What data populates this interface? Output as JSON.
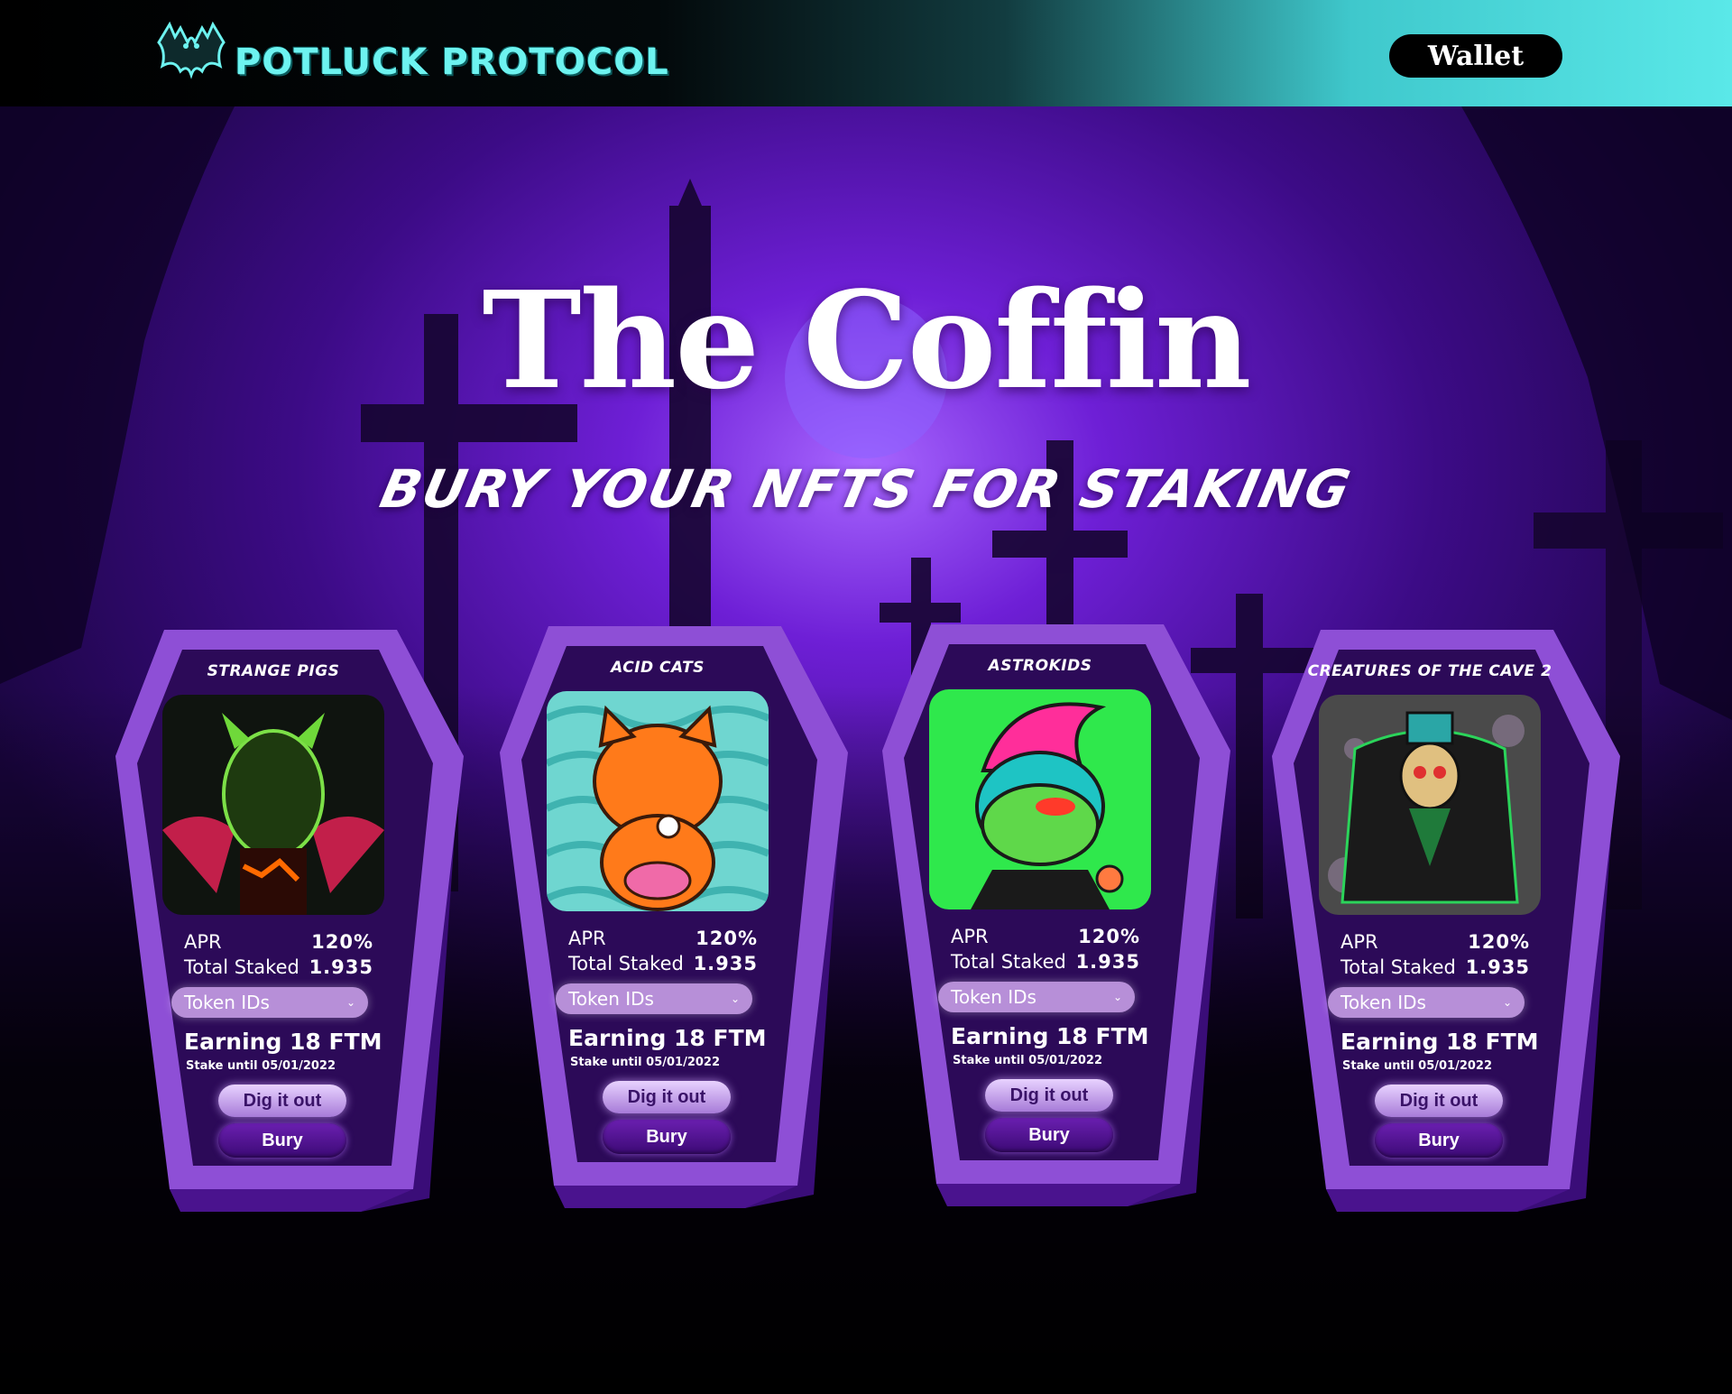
{
  "header": {
    "brand": "POTLUCK PROTOCOL",
    "wallet_label": "Wallet"
  },
  "hero": {
    "title": "The Coffin",
    "subtitle": "BURY YOUR NFTS FOR STAKING"
  },
  "colors": {
    "accent": "#6df3f0",
    "coffin_purple": "#7b2fc6",
    "background": "#2a0a55"
  },
  "coffins": [
    {
      "title": "Strange Pigs",
      "apr_label": "APR",
      "apr": "120%",
      "staked_label": "Total Staked",
      "staked": "1.935",
      "token_label": "Token IDs",
      "earning": "Earning 18 FTM",
      "stake_until": "Stake until 05/01/2022",
      "dig_label": "Dig it out",
      "bury_label": "Bury"
    },
    {
      "title": "Acid Cats",
      "apr_label": "APR",
      "apr": "120%",
      "staked_label": "Total Staked",
      "staked": "1.935",
      "token_label": "Token IDs",
      "earning": "Earning 18 FTM",
      "stake_until": "Stake until 05/01/2022",
      "dig_label": "Dig it out",
      "bury_label": "Bury"
    },
    {
      "title": "Astrokids",
      "apr_label": "APR",
      "apr": "120%",
      "staked_label": "Total Staked",
      "staked": "1.935",
      "token_label": "Token IDs",
      "earning": "Earning 18 FTM",
      "stake_until": "Stake until 05/01/2022",
      "dig_label": "Dig it out",
      "bury_label": "Bury"
    },
    {
      "title": "Creatures of the Cave 2",
      "apr_label": "APR",
      "apr": "120%",
      "staked_label": "Total Staked",
      "staked": "1.935",
      "token_label": "Token IDs",
      "earning": "Earning 18 FTM",
      "stake_until": "Stake until 05/01/2022",
      "dig_label": "Dig it out",
      "bury_label": "Bury"
    }
  ]
}
